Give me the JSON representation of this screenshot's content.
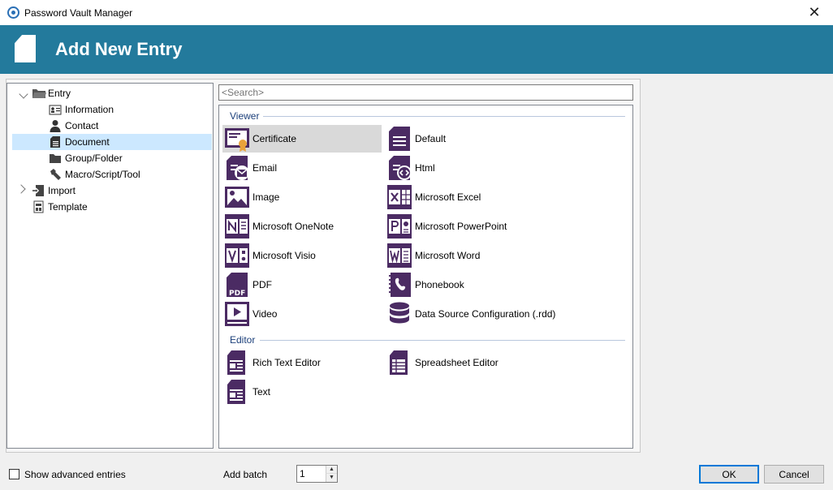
{
  "window": {
    "title": "Password Vault Manager",
    "close_glyph": "✕"
  },
  "banner": {
    "heading": "Add New Entry"
  },
  "tree": {
    "items": [
      {
        "label": "Entry",
        "icon": "folder-open-icon"
      },
      {
        "label": "Information",
        "icon": "id-card-icon"
      },
      {
        "label": "Contact",
        "icon": "person-icon"
      },
      {
        "label": "Document",
        "icon": "document-icon"
      },
      {
        "label": "Group/Folder",
        "icon": "folder-icon"
      },
      {
        "label": "Macro/Script/Tool",
        "icon": "tool-icon"
      },
      {
        "label": "Import",
        "icon": "import-icon"
      },
      {
        "label": "Template",
        "icon": "template-icon"
      }
    ],
    "selected": "Document"
  },
  "search": {
    "placeholder": "<Search>"
  },
  "groups": [
    {
      "name": "Viewer",
      "items": [
        {
          "label": "Certificate",
          "icon": "certificate-icon",
          "selected": true
        },
        {
          "label": "Default",
          "icon": "default-doc-icon"
        },
        {
          "label": "Email",
          "icon": "email-doc-icon"
        },
        {
          "label": "Html",
          "icon": "html-doc-icon"
        },
        {
          "label": "Image",
          "icon": "image-icon"
        },
        {
          "label": "Microsoft Excel",
          "icon": "excel-icon"
        },
        {
          "label": "Microsoft OneNote",
          "icon": "onenote-icon"
        },
        {
          "label": "Microsoft PowerPoint",
          "icon": "powerpoint-icon"
        },
        {
          "label": "Microsoft Visio",
          "icon": "visio-icon"
        },
        {
          "label": "Microsoft Word",
          "icon": "word-icon"
        },
        {
          "label": "PDF",
          "icon": "pdf-icon"
        },
        {
          "label": "Phonebook",
          "icon": "phonebook-icon"
        },
        {
          "label": "Video",
          "icon": "video-icon"
        },
        {
          "label": "Data Source Configuration (.rdd)",
          "icon": "database-icon"
        }
      ]
    },
    {
      "name": "Editor",
      "items": [
        {
          "label": "Rich Text Editor",
          "icon": "rich-text-icon"
        },
        {
          "label": "Spreadsheet Editor",
          "icon": "spreadsheet-icon"
        },
        {
          "label": "Text",
          "icon": "text-doc-icon"
        }
      ]
    }
  ],
  "footer": {
    "advanced_label": "Show advanced entries",
    "advanced_checked": false,
    "batch_label": "Add batch",
    "batch_value": "1",
    "ok_label": "OK",
    "cancel_label": "Cancel"
  },
  "colors": {
    "banner": "#237a9c",
    "icon_purple": "#4b2b63",
    "selection": "#cce8ff"
  }
}
